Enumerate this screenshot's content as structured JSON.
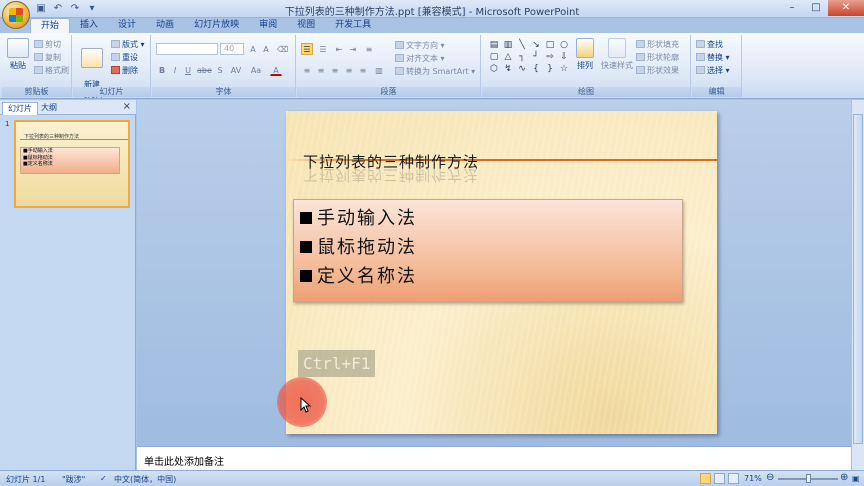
{
  "window": {
    "title": "下拉列表的三种制作方法.ppt [兼容模式] - Microsoft PowerPoint",
    "controls": [
      "–",
      "□",
      "✕"
    ]
  },
  "quick_access": [
    "save-icon",
    "undo-icon",
    "redo-icon",
    "customize-icon"
  ],
  "ribbon_tabs": [
    {
      "label": "开始",
      "active": true
    },
    {
      "label": "插入"
    },
    {
      "label": "设计"
    },
    {
      "label": "动画"
    },
    {
      "label": "幻灯片放映"
    },
    {
      "label": "审阅"
    },
    {
      "label": "视图"
    },
    {
      "label": "开发工具"
    }
  ],
  "ribbon": {
    "clipboard": {
      "label": "剪贴板",
      "paste": "粘贴",
      "cut": "剪切",
      "copy": "复制",
      "format_painter": "格式刷"
    },
    "slides": {
      "label": "幻灯片",
      "new_slide": "新建\n幻灯片",
      "layout": "版式",
      "reset": "重设",
      "delete": "删除"
    },
    "font": {
      "label": "字体",
      "font_name": "",
      "font_size": "40",
      "bold": "B",
      "italic": "I",
      "underline": "U",
      "strike": "abe",
      "shadow": "S",
      "spacing": "AV",
      "case": "Aa",
      "color": "A"
    },
    "paragraph": {
      "label": "段落",
      "text_direction": "文字方向",
      "align_text": "对齐文本",
      "smartart": "转换为 SmartArt"
    },
    "drawing": {
      "label": "绘图",
      "arrange": "排列",
      "quick_styles": "快速样式",
      "shape_fill": "形状填充",
      "shape_outline": "形状轮廓",
      "shape_effects": "形状效果"
    },
    "editing": {
      "label": "编辑",
      "find": "查找",
      "replace": "替换",
      "select": "选择"
    }
  },
  "left_panel": {
    "tabs": [
      "幻灯片",
      "大纲"
    ],
    "close": "×",
    "slide_number": "1"
  },
  "slide": {
    "title": "下拉列表的三种制作方法",
    "bullets": [
      "手动输入法",
      "鼠标拖动法",
      "定义名称法"
    ],
    "shortcut_hint": "Ctrl+F1"
  },
  "notes": {
    "placeholder": "单击此处添加备注"
  },
  "status_bar": {
    "slide_info": "幻灯片 1/1",
    "theme": "\"跋涉\"",
    "language": "中文(简体，中国)",
    "zoom": "71%"
  },
  "colors": {
    "ribbon_bg": "#dbe7f6",
    "slide_bg": "#fbeecb",
    "textbox_fill": "#f3b995",
    "title_rule": "#d6701e",
    "click_highlight": "#eb5546"
  }
}
